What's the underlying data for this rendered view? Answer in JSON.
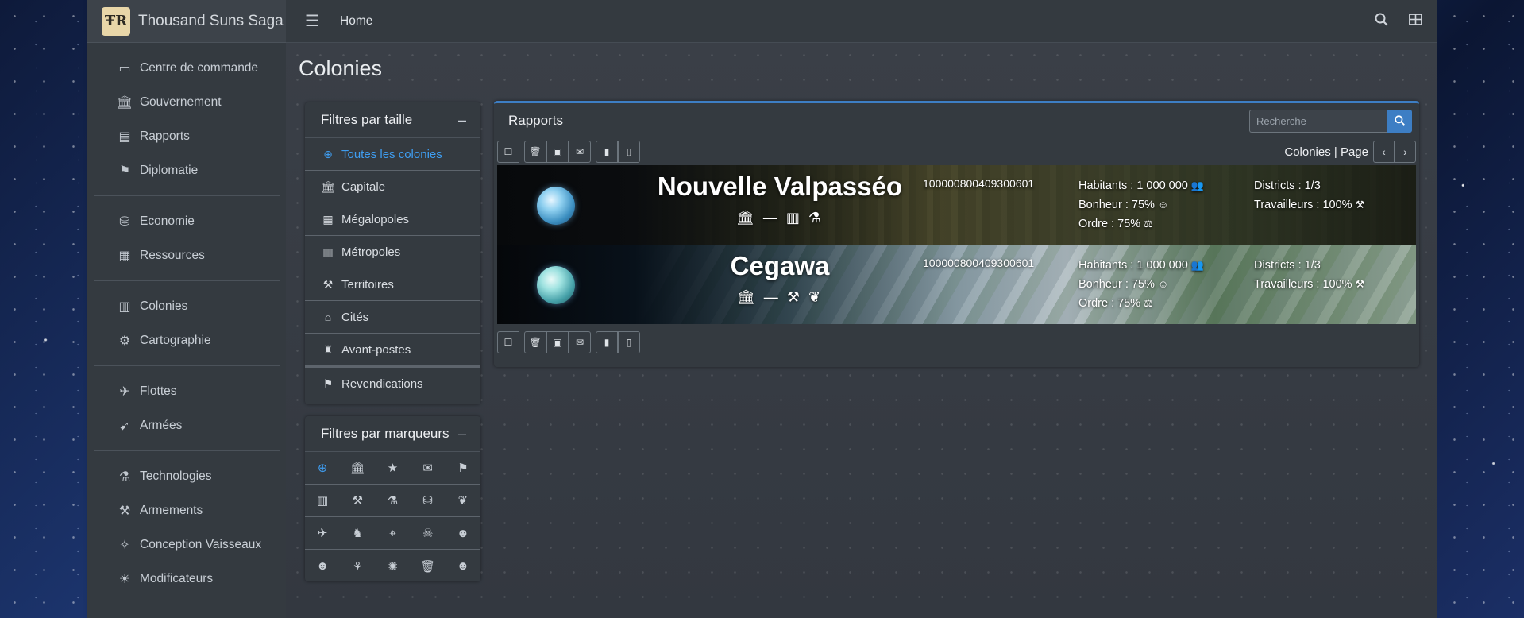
{
  "brand": {
    "name": "Thousand Suns Saga",
    "logo_text": "ŦR"
  },
  "sidebar": {
    "groups": [
      [
        {
          "label": "Centre de commande",
          "icon": "monitor-icon",
          "glyph": "▭"
        },
        {
          "label": "Gouvernement",
          "icon": "landmark-icon",
          "glyph": "🏛"
        },
        {
          "label": "Rapports",
          "icon": "inbox-icon",
          "glyph": "▤"
        },
        {
          "label": "Diplomatie",
          "icon": "broadcast-tower-icon",
          "glyph": "⚑"
        }
      ],
      [
        {
          "label": "Economie",
          "icon": "coins-icon",
          "glyph": "⛁"
        },
        {
          "label": "Ressources",
          "icon": "cubes-icon",
          "glyph": "▦"
        }
      ],
      [
        {
          "label": "Colonies",
          "icon": "city-icon",
          "glyph": "▥"
        },
        {
          "label": "Cartographie",
          "icon": "cog-icon",
          "glyph": "⚙"
        }
      ],
      [
        {
          "label": "Flottes",
          "icon": "plane-icon",
          "glyph": "✈"
        },
        {
          "label": "Armées",
          "icon": "fighter-jet-icon",
          "glyph": "➹"
        }
      ],
      [
        {
          "label": "Technologies",
          "icon": "flask-icon",
          "glyph": "⚗"
        },
        {
          "label": "Armements",
          "icon": "wrench-icon",
          "glyph": "⚒"
        },
        {
          "label": "Conception Vaisseaux",
          "icon": "drafting-compass-icon",
          "glyph": "✧"
        },
        {
          "label": "Modificateurs",
          "icon": "lightbulb-icon",
          "glyph": "☀"
        }
      ]
    ]
  },
  "topbar": {
    "home": "Home"
  },
  "page": {
    "title": "Colonies"
  },
  "size_filters": {
    "title": "Filtres par taille",
    "items": [
      {
        "label": "Toutes les colonies",
        "glyph": "⊕",
        "active": true
      },
      {
        "label": "Capitale",
        "glyph": "🏛"
      },
      {
        "label": "Mégalopoles",
        "glyph": "▦"
      },
      {
        "label": "Métropoles",
        "glyph": "▥"
      },
      {
        "label": "Territoires",
        "glyph": "⚒"
      },
      {
        "label": "Cités",
        "glyph": "⌂"
      },
      {
        "label": "Avant-postes",
        "glyph": "♜"
      },
      {
        "label": "Revendications",
        "glyph": "⚑"
      }
    ]
  },
  "marker_filters": {
    "title": "Filtres par marqueurs",
    "rows": [
      [
        "⊕",
        "🏛",
        "★",
        "✉",
        "⚑"
      ],
      [
        "▥",
        "⚒",
        "⚗",
        "⛁",
        "❦"
      ],
      [
        "✈",
        "♞",
        "⌖",
        "☠",
        "☻"
      ],
      [
        "☻",
        "⚘",
        "✺",
        "🗑",
        "☻"
      ]
    ]
  },
  "reports": {
    "title": "Rapports",
    "search_placeholder": "Recherche",
    "pager_label": "Colonies | Page"
  },
  "colonies": [
    {
      "name": "Nouvelle Valpasséo",
      "tags": "🏛 — ▥ ⚗",
      "id": "100000800409300601",
      "habitants": "Habitants : 1 000 000",
      "bonheur": "Bonheur : 75%",
      "ordre": "Ordre : 75%",
      "districts": "Districts : 1/3",
      "travailleurs": "Travailleurs : 100%"
    },
    {
      "name": "Cegawa",
      "tags": "🏛 — ⚒ ❦",
      "id": "100000800409300601",
      "habitants": "Habitants : 1 000 000",
      "bonheur": "Bonheur : 75%",
      "ordre": "Ordre : 75%",
      "districts": "Districts : 1/3",
      "travailleurs": "Travailleurs : 100%"
    }
  ]
}
